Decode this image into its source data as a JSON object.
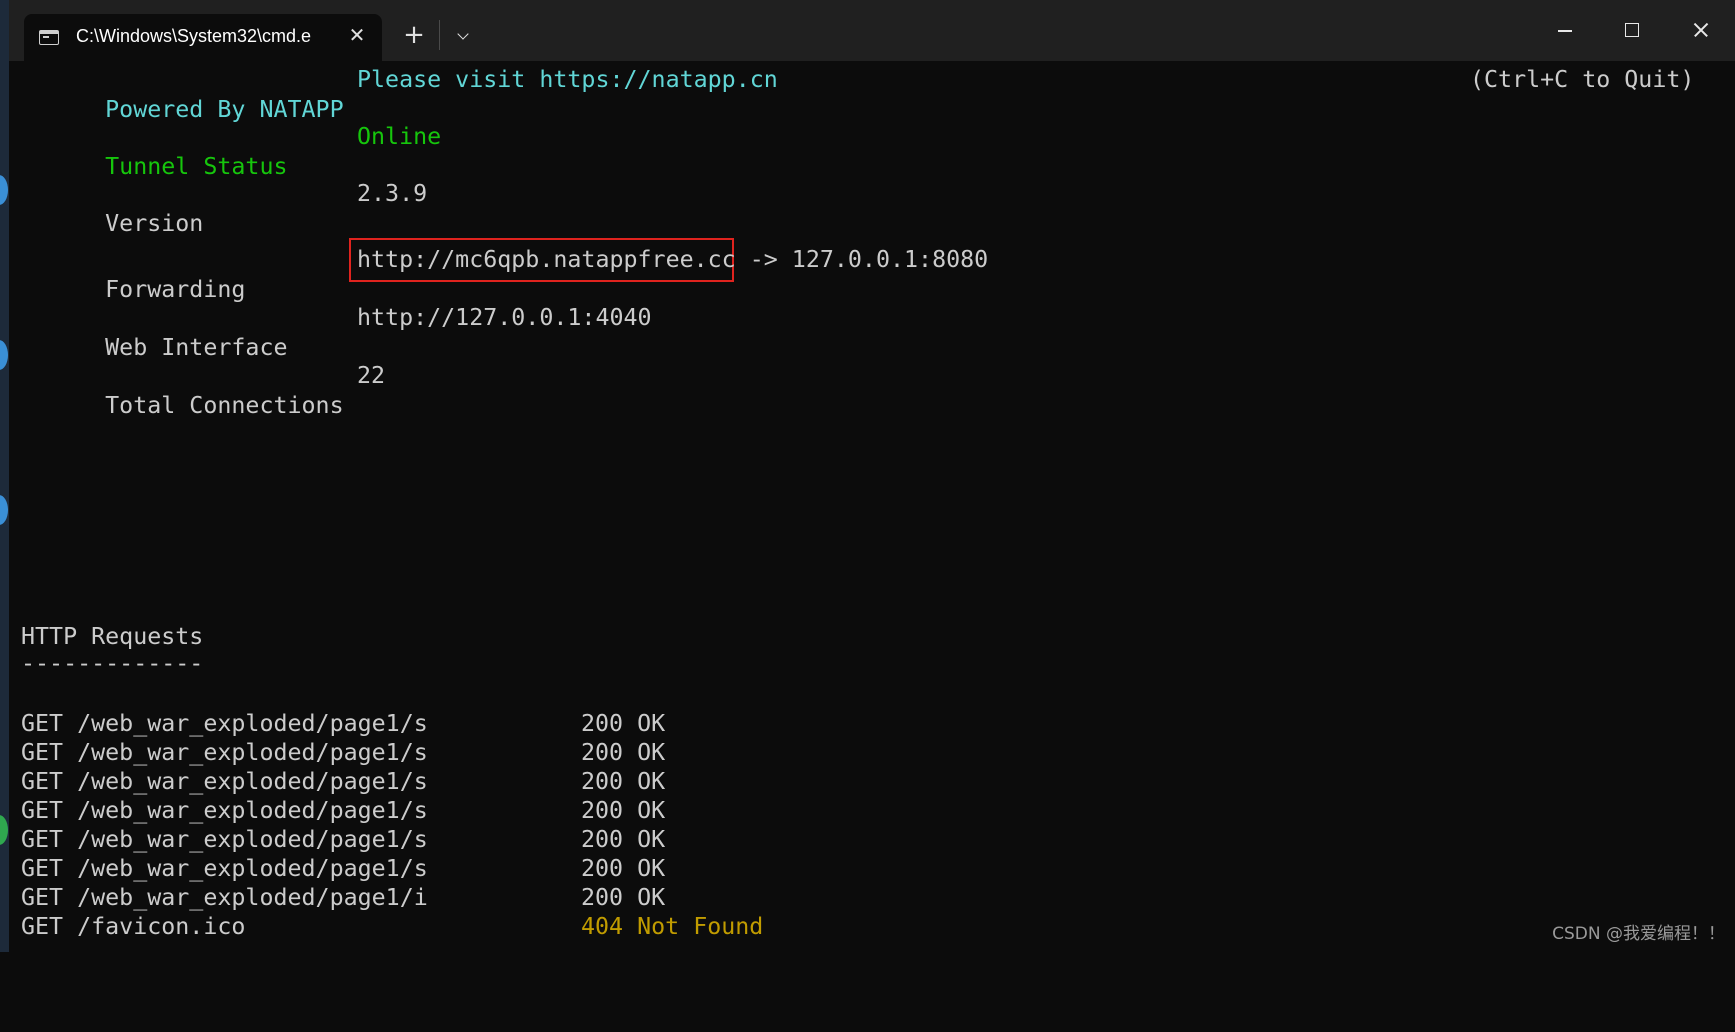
{
  "window": {
    "tab_title": "C:\\Windows\\System32\\cmd.e",
    "tab_icon": "terminal-icon",
    "new_tab_symbol": "+",
    "close_symbol": "✕"
  },
  "terminal": {
    "powered_by": "Powered By NATAPP",
    "visit": "Please visit https://natapp.cn",
    "quit_hint": "(Ctrl+C to Quit)",
    "tunnel_status_label": "Tunnel Status",
    "tunnel_status_value": "Online",
    "version_label": "Version",
    "version_value": "2.3.9",
    "forwarding_label": "Forwarding",
    "forwarding_url": "http://mc6qpb.natappfree.cc",
    "forwarding_target": " -> 127.0.0.1:8080",
    "web_interface_label": "Web Interface",
    "web_interface_value": "http://127.0.0.1:4040",
    "total_connections_label": "Total Connections",
    "total_connections_value": "22",
    "http_requests_title": "HTTP Requests",
    "http_requests_rule": "-------------",
    "requests": [
      {
        "path": "GET /web_war_exploded/page1/s",
        "status": "200 OK"
      },
      {
        "path": "GET /web_war_exploded/page1/s",
        "status": "200 OK"
      },
      {
        "path": "GET /web_war_exploded/page1/s",
        "status": "200 OK"
      },
      {
        "path": "GET /web_war_exploded/page1/s",
        "status": "200 OK"
      },
      {
        "path": "GET /web_war_exploded/page1/s",
        "status": "200 OK"
      },
      {
        "path": "GET /web_war_exploded/page1/s",
        "status": "200 OK"
      },
      {
        "path": "GET /web_war_exploded/page1/i",
        "status": "200 OK"
      },
      {
        "path": "GET /favicon.ico",
        "status": "404 Not Found"
      }
    ]
  },
  "colors": {
    "cyan": "#61d6d6",
    "green": "#16c60c",
    "yellow": "#c19c00",
    "highlight_border": "#e0231e"
  },
  "watermark": "CSDN @我爱编程！！"
}
